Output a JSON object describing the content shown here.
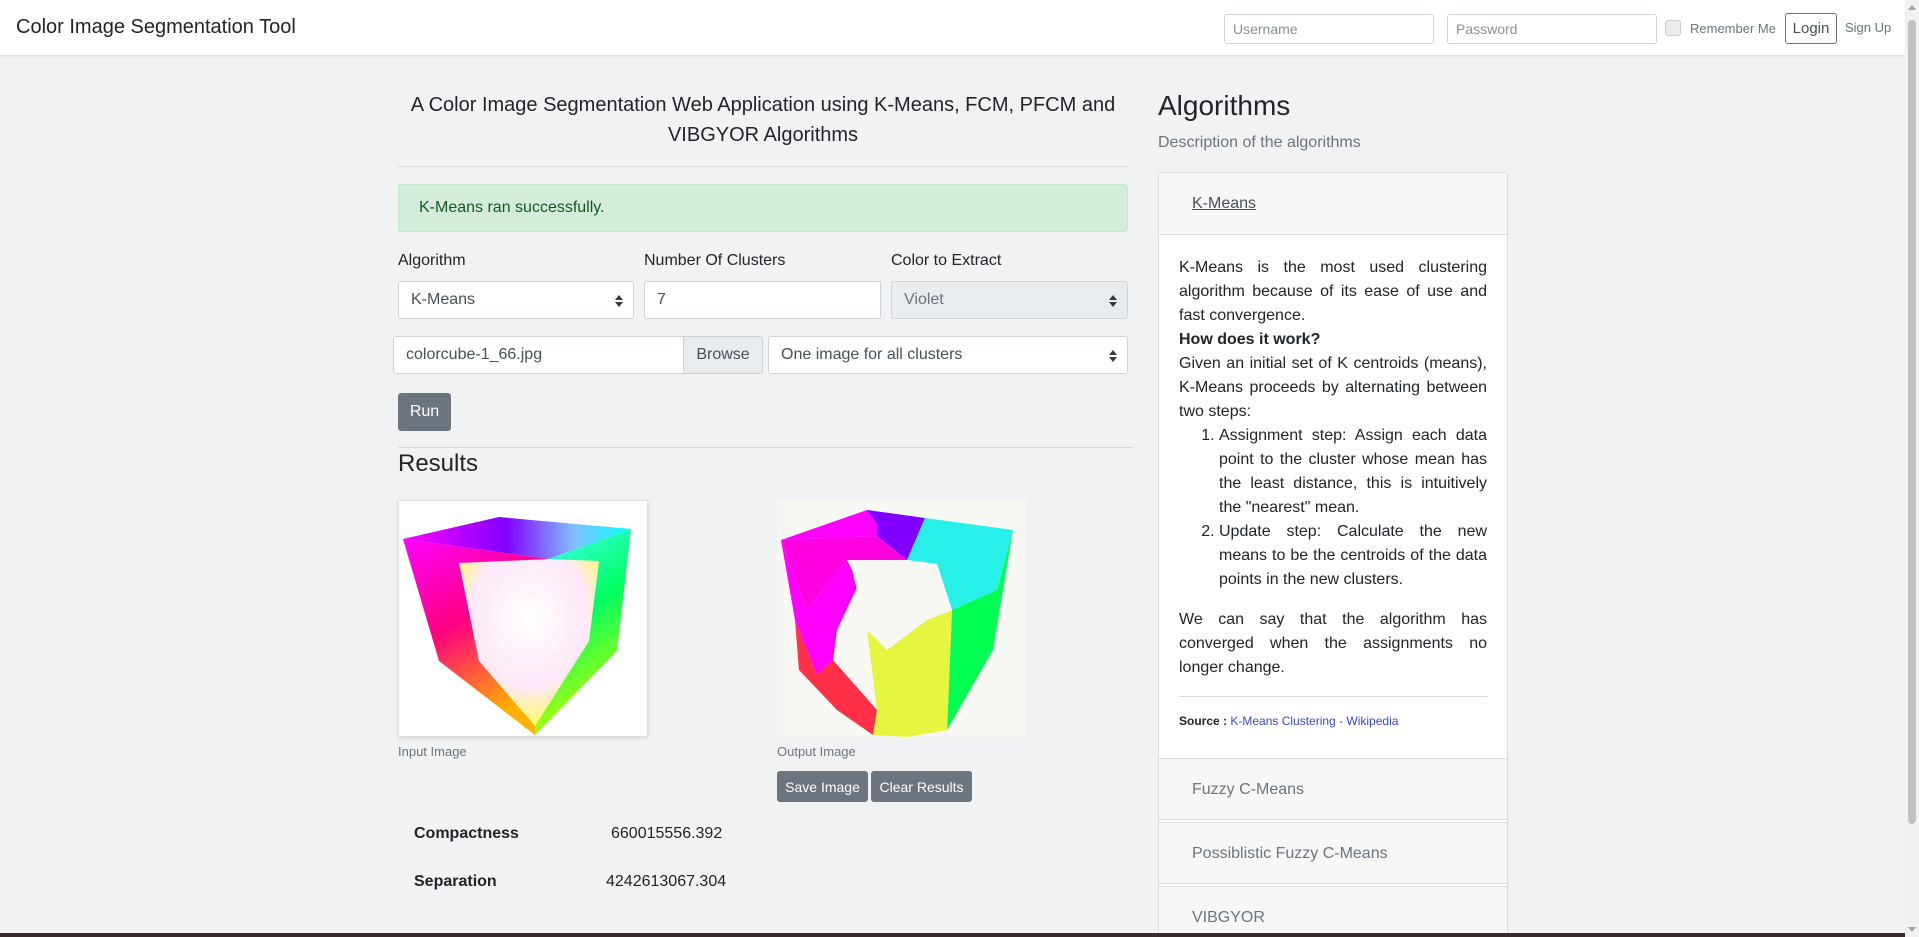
{
  "navbar": {
    "brand": "Color Image Segmentation Tool",
    "username_placeholder": "Username",
    "password_placeholder": "Password",
    "remember_label": "Remember Me",
    "login_label": "Login",
    "signup_label": "Sign Up"
  },
  "main": {
    "heading_line1": "A Color Image Segmentation Web Application using K-Means, FCM, PFCM and",
    "heading_line2": "VIBGYOR Algorithms",
    "alert": "K-Means ran successfully.",
    "form": {
      "algorithm_label": "Algorithm",
      "algorithm_value": "K-Means",
      "clusters_label": "Number Of Clusters",
      "clusters_value": "7",
      "color_label": "Color to Extract",
      "color_value": "Violet",
      "file_name": "colorcube-1_66.jpg",
      "browse_label": "Browse",
      "output_mode": "One image for all clusters",
      "run_label": "Run"
    },
    "results": {
      "title": "Results",
      "input_caption": "Input Image",
      "output_caption": "Output Image",
      "save_label": "Save Image",
      "clear_label": "Clear Results",
      "metrics": [
        {
          "label": "Compactness",
          "value": "660015556.392"
        },
        {
          "label": "Separation",
          "value": "4242613067.304"
        }
      ]
    }
  },
  "sidebar": {
    "title": "Algorithms",
    "subtitle": "Description of the algorithms",
    "accordion": [
      {
        "label": "K-Means"
      },
      {
        "label": "Fuzzy C-Means"
      },
      {
        "label": "Possiblistic Fuzzy C-Means"
      },
      {
        "label": "VIBGYOR"
      }
    ],
    "kmeans": {
      "intro": "K-Means is the most used clustering algorithm because of its ease of use and fast convergence.",
      "how_title": "How does it work?",
      "how_text": "Given an initial set of K centroids (means), K-Means proceeds by alternating between two steps:",
      "steps": [
        "Assignment step: Assign each data point to the cluster whose mean has the least distance, this is intuitively the \"nearest\" mean.",
        "Update step: Calculate the new means to be the centroids of the data points in the new clusters."
      ],
      "conclusion": "We can say that the algorithm has converged when the assignments no longer change.",
      "source_label": "Source :",
      "source_link": "K-Means Clustering - Wikipedia"
    }
  }
}
